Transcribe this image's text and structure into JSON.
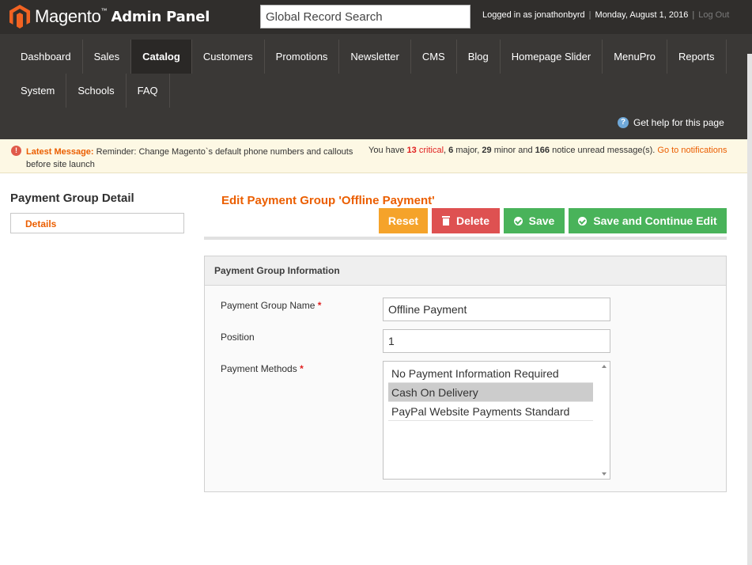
{
  "header": {
    "brand": "Magento",
    "brand_tm": "™",
    "brand_suffix": "Admin Panel",
    "search_placeholder": "Global Record Search",
    "logged_in": "Logged in as jonathonbyrd",
    "date": "Monday, August 1, 2016",
    "logout": "Log Out",
    "separator": "|"
  },
  "nav": {
    "row1": [
      "Dashboard",
      "Sales",
      "Catalog",
      "Customers",
      "Promotions",
      "Newsletter",
      "CMS",
      "Blog",
      "Homepage Slider",
      "MenuPro",
      "Reports"
    ],
    "row2": [
      "System",
      "Schools",
      "FAQ"
    ],
    "active": "Catalog",
    "help": "Get help for this page"
  },
  "message": {
    "title": "Latest Message:",
    "text": "Reminder: Change Magento`s default phone numbers and callouts before site launch",
    "you_have": "You have",
    "critical_count": "13",
    "critical_label": "critical",
    "major_count": "6",
    "major_label": "major",
    "minor_count": "29",
    "minor_label": "minor and",
    "notice_count": "166",
    "notice_label": "notice unread message(s).",
    "link": "Go to notifications"
  },
  "sidebar": {
    "title": "Payment Group Detail",
    "tab": "Details"
  },
  "main": {
    "title": "Edit Payment Group 'Offline Payment'",
    "buttons": {
      "reset": "Reset",
      "delete": "Delete",
      "save": "Save",
      "save_continue": "Save and Continue Edit"
    },
    "fieldset_title": "Payment Group Information",
    "fields": {
      "name_label": "Payment Group Name",
      "name_value": "Offline Payment",
      "position_label": "Position",
      "position_value": "1",
      "methods_label": "Payment Methods",
      "required_mark": "*"
    },
    "methods": [
      {
        "label": "No Payment Information Required",
        "selected": false
      },
      {
        "label": "Cash On Delivery",
        "selected": true
      },
      {
        "label": "PayPal Website Payments Standard",
        "selected": false
      }
    ]
  },
  "colors": {
    "accent": "#eb5e00",
    "reset": "#f5a32a",
    "delete": "#de5151",
    "save": "#49b35a",
    "header_bg": "#3a3836"
  }
}
